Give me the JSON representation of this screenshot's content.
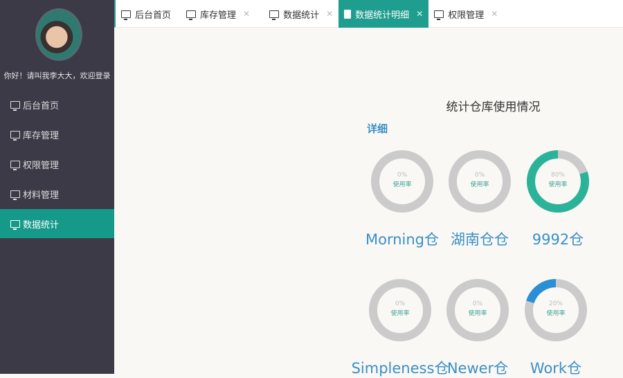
{
  "sidebar": {
    "greeting": "你好！请叫我李大大，欢迎登录",
    "items": [
      {
        "label": "后台首页"
      },
      {
        "label": "库存管理"
      },
      {
        "label": "权限管理"
      },
      {
        "label": "材料管理"
      },
      {
        "label": "数据统计",
        "active": true
      }
    ]
  },
  "tabs": [
    {
      "label": "后台首页",
      "closable": false,
      "icon": "monitor-icon"
    },
    {
      "label": "库存管理",
      "closable": true,
      "icon": "monitor-icon"
    },
    {
      "label": "数据统计",
      "closable": true,
      "icon": "monitor-icon"
    },
    {
      "label": "数据统计明细",
      "closable": true,
      "active": true,
      "icon": "document-icon"
    },
    {
      "label": "权限管理",
      "closable": true,
      "icon": "monitor-icon"
    }
  ],
  "close_glyph": "✕",
  "main": {
    "title": "统计仓库使用情况",
    "detail_label": "详细",
    "usage_label": "使用率",
    "warehouses": [
      {
        "name": "Morning仓",
        "percent": 0,
        "pct_text": "0%",
        "color": "#2bb39a"
      },
      {
        "name": "湖南仓仓",
        "percent": 0,
        "pct_text": "0%",
        "color": "#2bb39a"
      },
      {
        "name": "9992仓",
        "percent": 80,
        "pct_text": "80%",
        "color": "#2bb39a"
      },
      {
        "name": "Simpleness仓",
        "percent": 0,
        "pct_text": "0%",
        "color": "#2b8fd6"
      },
      {
        "name": "Newer仓",
        "percent": 0,
        "pct_text": "0%",
        "color": "#2b8fd6"
      },
      {
        "name": "Work仓",
        "percent": 20,
        "pct_text": "20%",
        "color": "#2b8fd6"
      }
    ]
  }
}
